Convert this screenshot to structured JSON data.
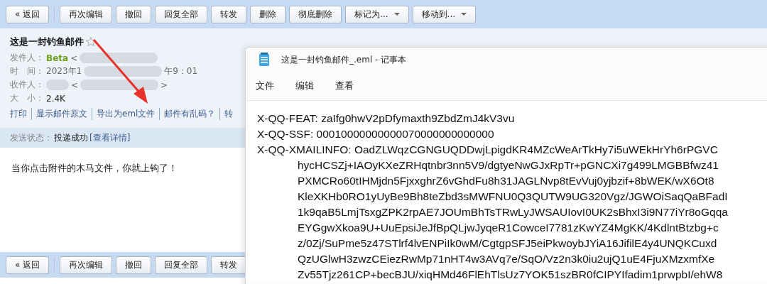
{
  "toolbar": [
    {
      "label": "« 返回",
      "kind": "back"
    },
    {
      "label": "再次编辑",
      "kind": "button"
    },
    {
      "label": "撤回",
      "kind": "button"
    },
    {
      "label": "回复全部",
      "kind": "button"
    },
    {
      "label": "转发",
      "kind": "button"
    },
    {
      "label": "删除",
      "kind": "button"
    },
    {
      "label": "彻底删除",
      "kind": "button"
    },
    {
      "label": "标记为...",
      "kind": "dropdown"
    },
    {
      "label": "移动到...",
      "kind": "dropdown"
    }
  ],
  "mail": {
    "subject": "这是一封钓鱼邮件",
    "fields": [
      {
        "label": "发件人：",
        "segments": [
          {
            "kind": "name",
            "text": "Beta"
          },
          {
            "kind": "text",
            "text": "<"
          },
          {
            "kind": "redacted"
          }
        ]
      },
      {
        "label": "时　间：",
        "segments": [
          {
            "kind": "text",
            "text": "2023年1"
          },
          {
            "kind": "redacted"
          },
          {
            "kind": "text",
            "text": "午9：01"
          }
        ]
      },
      {
        "label": "收件人：",
        "segments": [
          {
            "kind": "redacted"
          },
          {
            "kind": "text",
            "text": "<"
          },
          {
            "kind": "redacted"
          },
          {
            "kind": "text",
            "text": ">"
          }
        ]
      },
      {
        "label": "大　小：",
        "segments": [
          {
            "kind": "value",
            "text": "2.4K"
          }
        ]
      }
    ],
    "links": [
      "打印",
      "显示邮件原文",
      "导出为eml文件",
      "邮件有乱码？",
      "转"
    ],
    "status": {
      "label": "发送状态：",
      "value": "投递成功",
      "link": "[查看详情]"
    },
    "body": "当你点击附件的木马文件，你就上钩了！"
  },
  "bottom_toolbar": [
    {
      "label": "« 返回",
      "kind": "back"
    },
    {
      "label": "再次编辑",
      "kind": "button"
    },
    {
      "label": "撤回",
      "kind": "button"
    },
    {
      "label": "回复全部",
      "kind": "button"
    },
    {
      "label": "转发",
      "kind": "button"
    }
  ],
  "notepad": {
    "title": "这是一封钓鱼邮件_.eml - 记事本",
    "menu": [
      "文件",
      "编辑",
      "查看"
    ],
    "lines": [
      {
        "kind": "header",
        "text": "X-QQ-FEAT: zaIfg0hwV2pDfymaxth9ZbdZmJ4kV3vu"
      },
      {
        "kind": "header",
        "text": "X-QQ-SSF: 00010000000000070000000000000"
      },
      {
        "kind": "header",
        "text": "X-QQ-XMAILINFO: OadZLWqzCGNGUQDDwjLpigdKR4MZcWeArTkHy7i5uWEkHrYh6rPGVC"
      },
      {
        "kind": "cont",
        "text": "hycHCSZj+IAOyKXeZRHqtnbr3nn5V9/dgtyeNwGJxRpTr+pGNCXi7g499LMGBBfwz41"
      },
      {
        "kind": "cont",
        "text": "PXMCRo60tIHMjdn5FjxxghrZ6vGhdFu8h31JAGLNvp8tEvVuj0yjbzif+8bWEK/wX6Ot8"
      },
      {
        "kind": "cont",
        "text": "KleXKHb0RO1yUyBe9Bh8teZbd3sMWFNU0Q3QUTW9UG320Vgz/JGWOiSaqQaBFadI"
      },
      {
        "kind": "cont",
        "text": "1k9qaB5LmjTsxgZPK2rpAE7JOUmBhTsTRwLyJWSAUIovI0UK2sBhxI3i9N77iYr8oGqqa"
      },
      {
        "kind": "cont",
        "text": "EYGgwXkoa9U+UuEpsiJeJfBpQLjwJyqeR1CowceI7781zKwYZ4MgKK/4KdlntBtzbg+c"
      },
      {
        "kind": "cont",
        "text": "z/0Zj/SuPme5z47STlrf4lvENPiIk0wM/CgtgpSFJ5eiPkwoybJYiA16JifilE4y4UNQKCuxd"
      },
      {
        "kind": "cont",
        "text": "QzUGlwH3zwzCEiezRwMp71nHT4w3AVq7e/SqO/Vz2n3k0iu2ujQ1uE4FjuXMzxmfXe"
      },
      {
        "kind": "cont",
        "text": "Zv55Tjz261CP+becBJU/xiqHMd46FlEhTlsUz7YOK51szBR0fCIPYIfadim1prwpbI/ehW8"
      }
    ]
  }
}
